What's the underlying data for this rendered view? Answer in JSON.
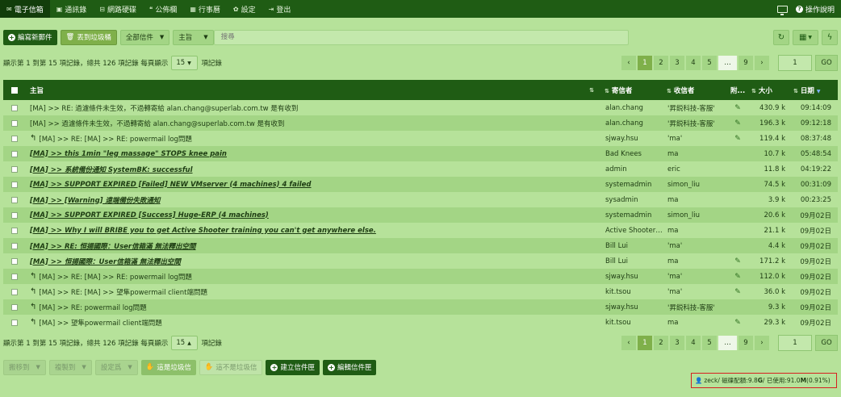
{
  "nav": {
    "items": [
      {
        "label": "電子信箱",
        "icon": "envelope-icon",
        "glyph": "✉",
        "active": true
      },
      {
        "label": "通訊錄",
        "icon": "address-book-icon",
        "glyph": "▣",
        "active": false
      },
      {
        "label": "網路硬碟",
        "icon": "drive-icon",
        "glyph": "⊟",
        "active": false
      },
      {
        "label": "公佈欄",
        "icon": "board-icon",
        "glyph": "❝",
        "active": false
      },
      {
        "label": "行事曆",
        "icon": "calendar-icon",
        "glyph": "▦",
        "active": false
      },
      {
        "label": "設定",
        "icon": "gear-icon",
        "glyph": "✿",
        "active": false
      },
      {
        "label": "登出",
        "icon": "logout-icon",
        "glyph": "⇥",
        "active": false
      }
    ],
    "help_label": "操作說明"
  },
  "toolbar": {
    "compose_label": "編寫新郵件",
    "trash_label": "丟到垃圾桶",
    "folder_filter": "全部信件",
    "field_filter": "主旨",
    "search_placeholder": "搜尋"
  },
  "pagination": {
    "info_top": "顯示第 1 到第 15 項記錄，總共 126 項記錄 每頁顯示",
    "info_bottom": "顯示第 1 到第 15 項記錄，總共 126 項記錄 每頁顯示",
    "per_page": "15",
    "suffix": "項記錄",
    "prev": "‹",
    "pages": [
      "1",
      "2",
      "3",
      "4",
      "5",
      "…",
      "9"
    ],
    "current": "1",
    "next": "›",
    "goto_value": "1",
    "go_label": "GO"
  },
  "table": {
    "headers": {
      "subject": "主旨",
      "from": "寄信者",
      "to": "收信者",
      "attach": "附...",
      "size": "大小",
      "date": "日期"
    },
    "rows": [
      {
        "subject": "[MA] >> RE: 過濾條件未生效，不過轉寄給 alan.chang@superlab.com.tw 是有收到",
        "from": "alan.chang",
        "to": "'昇鋭科技-客服'",
        "att": true,
        "size": "430.9 k",
        "date": "09:14:09",
        "unread": false,
        "reply": false
      },
      {
        "subject": "[MA] >> 過濾條件未生效，不過轉寄給 alan.chang@superlab.com.tw 是有收到",
        "from": "alan.chang",
        "to": "'昇鋭科技-客服'",
        "att": true,
        "size": "196.3 k",
        "date": "09:12:18",
        "unread": false,
        "reply": false
      },
      {
        "subject": "[MA] >> RE: [MA] >> RE: powermail log問題",
        "from": "sjway.hsu",
        "to": "'ma'",
        "att": true,
        "size": "119.4 k",
        "date": "08:37:48",
        "unread": false,
        "reply": true
      },
      {
        "subject": "[MA] >> this 1min \"leg massage\" STOPS knee pain",
        "from": "Bad Knees",
        "to": "ma",
        "att": false,
        "size": "10.7 k",
        "date": "05:48:54",
        "unread": true,
        "reply": false
      },
      {
        "subject": "[MA] >> 系統備份通知 SystemBK: successful",
        "from": "admin",
        "to": "eric",
        "att": false,
        "size": "11.8 k",
        "date": "04:19:22",
        "unread": true,
        "reply": false
      },
      {
        "subject": "[MA] >> SUPPORT EXPIRED [Failed] NEW VMserver (4 machines) 4 failed",
        "from": "systemadmin",
        "to": "simon_liu",
        "att": false,
        "size": "74.5 k",
        "date": "00:31:09",
        "unread": true,
        "reply": false
      },
      {
        "subject": "[MA] >> [Warning] 遠端備份失敗通知",
        "from": "sysadmin",
        "to": "ma",
        "att": false,
        "size": "3.9 k",
        "date": "00:23:25",
        "unread": true,
        "reply": false
      },
      {
        "subject": "[MA] >> SUPPORT EXPIRED [Success] Huge-ERP (4 machines)",
        "from": "systemadmin",
        "to": "simon_liu",
        "att": false,
        "size": "20.6 k",
        "date": "09月02日",
        "unread": true,
        "reply": false
      },
      {
        "subject": "[MA] >> Why I will BRIBE you to get Active Shooter training you can't get anywhere else.",
        "from": "Active Shooter Training",
        "to": "ma",
        "att": false,
        "size": "21.1 k",
        "date": "09月02日",
        "unread": true,
        "reply": false
      },
      {
        "subject": "[MA] >> RE: 恒揚國際：User信箱滿 無法釋出空間",
        "from": "Bill Lui",
        "to": "'ma'",
        "att": false,
        "size": "4.4 k",
        "date": "09月02日",
        "unread": true,
        "reply": false
      },
      {
        "subject": "[MA] >> 恒揚國際：User信箱滿 無法釋出空間",
        "from": "Bill Lui",
        "to": "ma",
        "att": true,
        "size": "171.2 k",
        "date": "09月02日",
        "unread": true,
        "reply": false
      },
      {
        "subject": "[MA] >> RE: [MA] >> RE: powermail log問題",
        "from": "sjway.hsu",
        "to": "'ma'",
        "att": true,
        "size": "112.0 k",
        "date": "09月02日",
        "unread": false,
        "reply": true
      },
      {
        "subject": "[MA] >> RE: [MA] >> 望隼powermail client端問題",
        "from": "kit.tsou",
        "to": "'ma'",
        "att": true,
        "size": "36.0 k",
        "date": "09月02日",
        "unread": false,
        "reply": true
      },
      {
        "subject": "[MA] >> RE: powermail log問題",
        "from": "sjway.hsu",
        "to": "'昇鋭科技-客服'",
        "att": false,
        "size": "9.3 k",
        "date": "09月02日",
        "unread": false,
        "reply": true
      },
      {
        "subject": "[MA] >> 望隼powermail client端問題",
        "from": "kit.tsou",
        "to": "ma",
        "att": true,
        "size": "29.3 k",
        "date": "09月02日",
        "unread": false,
        "reply": true
      }
    ]
  },
  "actions": {
    "move_to": "搬移到",
    "copy_to": "複製到",
    "set_as": "設定爲",
    "mark_spam": "這是垃圾信",
    "not_spam": "這不是垃圾信",
    "create_folder": "建立信件匣",
    "edit_folder": "編輯信件匣"
  },
  "quota": {
    "user": "zeck",
    "sep1": " / 磁碟配額:",
    "quota_num": "9.8",
    "quota_unit": "G",
    "sep2": " / 已使用:",
    "used_num": "91.0",
    "used_unit": "M",
    "pct": "(0.91%)"
  }
}
